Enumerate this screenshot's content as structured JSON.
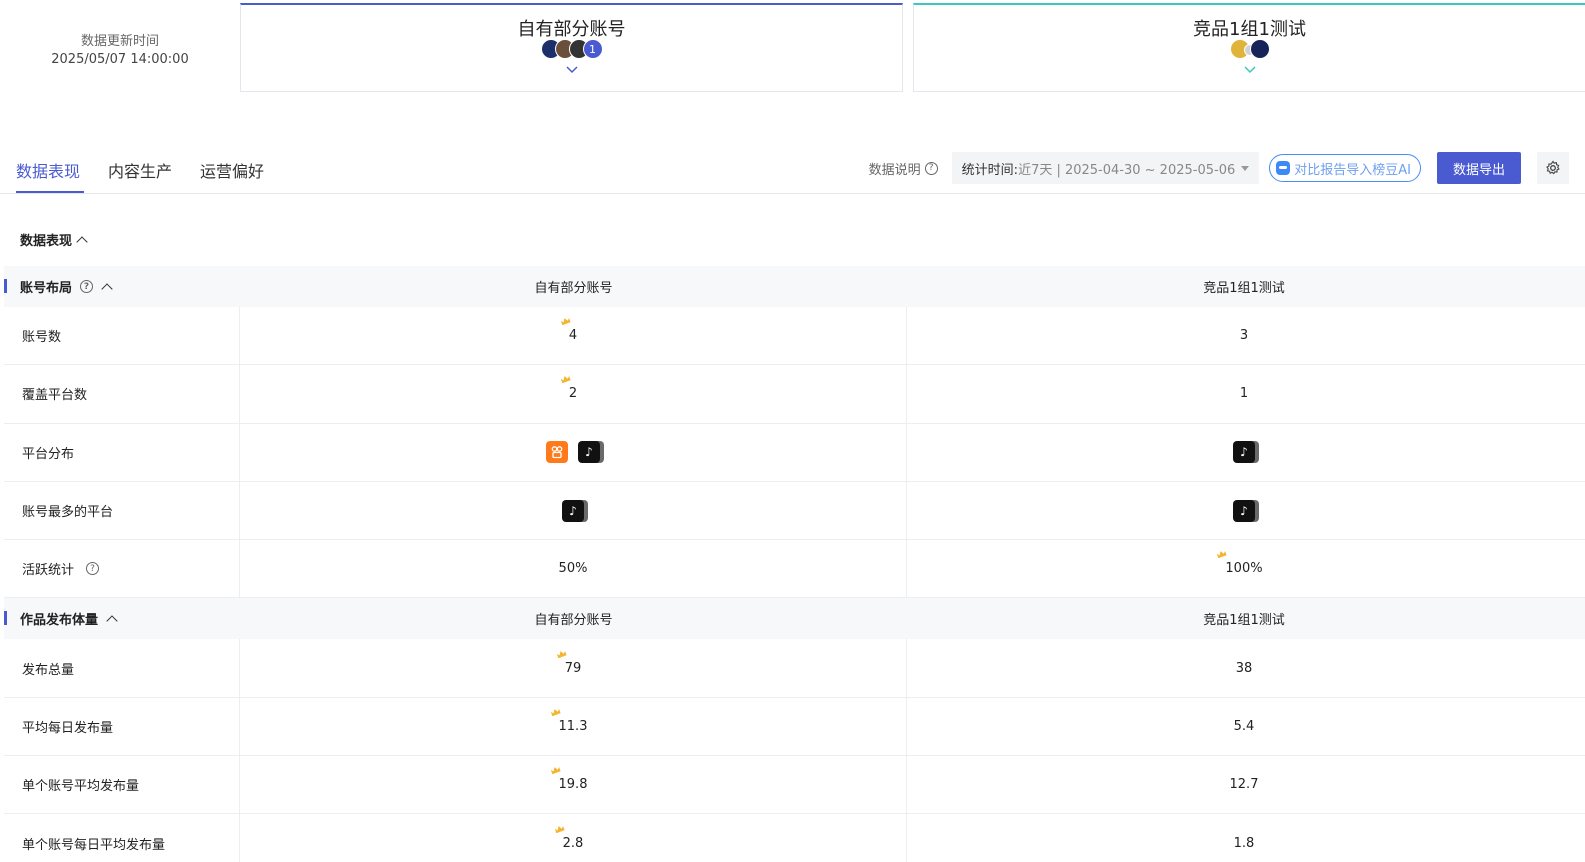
{
  "update": {
    "label": "数据更新时间",
    "time": "2025/05/07 14:00:00"
  },
  "groups": [
    {
      "title": "自有部分账号",
      "count_badge": "1",
      "accent": "#4a5bd1"
    },
    {
      "title": "竞品1组1测试",
      "accent": "#3cc8bd"
    }
  ],
  "tabs": [
    "数据表现",
    "内容生产",
    "运营偏好"
  ],
  "toolbar": {
    "explain": "数据说明",
    "stat_label": "统计时间:",
    "stat_value": "近7天 | 2025-04-30 ~ 2025-05-06",
    "ai_label": "对比报告导入榜豆AI",
    "export_label": "数据导出"
  },
  "section": {
    "title": "数据表现"
  },
  "account_layout": {
    "title": "账号布局",
    "col1": "自有部分账号",
    "col2": "竞品1组1测试",
    "rows": [
      {
        "name": "账号数",
        "v1": "4",
        "v2": "3"
      },
      {
        "name": "覆盖平台数",
        "v1": "2",
        "v2": "1"
      },
      {
        "name": "平台分布",
        "v1_icons": [
          "kuaishou-icon",
          "douyin-icon"
        ],
        "v2_icons": [
          "douyin-icon"
        ]
      },
      {
        "name": "账号最多的平台",
        "v1_icons": [
          "douyin-icon"
        ],
        "v2_icons": [
          "douyin-icon"
        ]
      },
      {
        "name": "活跃统计",
        "v1": "50%",
        "v2": "100%"
      }
    ]
  },
  "publish_volume": {
    "title": "作品发布体量",
    "col1": "自有部分账号",
    "col2": "竞品1组1测试",
    "rows": [
      {
        "name": "发布总量",
        "v1": "79",
        "v2": "38"
      },
      {
        "name": "平均每日发布量",
        "v1": "11.3",
        "v2": "5.4"
      },
      {
        "name": "单个账号平均发布量",
        "v1": "19.8",
        "v2": "12.7"
      },
      {
        "name": "单个账号每日平均发布量",
        "v1": "2.8",
        "v2": "1.8"
      }
    ]
  },
  "colors": {
    "primary": "#4a5bd1",
    "teal": "#3cc8bd",
    "crown": "#f2b632",
    "kuaishou": "#ff7a1a",
    "douyin": "#111111"
  }
}
